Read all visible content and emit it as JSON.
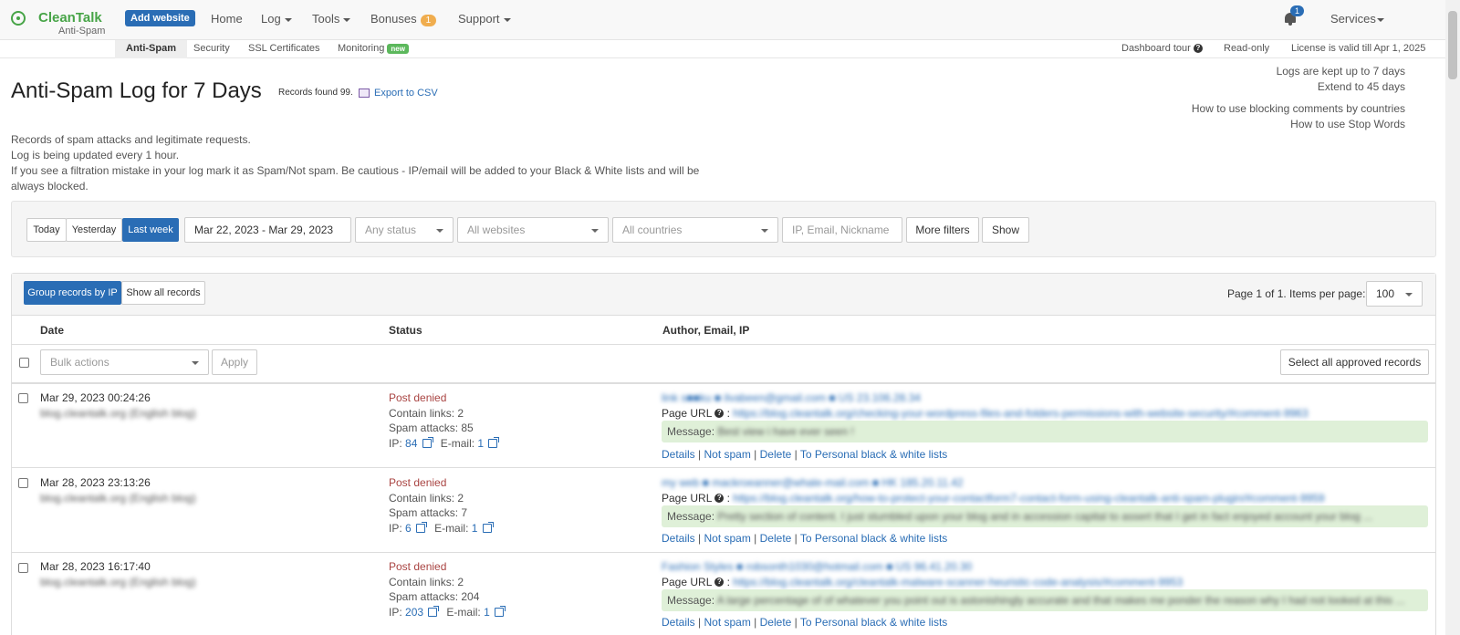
{
  "header": {
    "logo": "CleanTalk",
    "logo_sub": "Anti-Spam",
    "add_website": "Add website",
    "nav": {
      "home": "Home",
      "log": "Log",
      "tools": "Tools",
      "bonuses": "Bonuses",
      "bonuses_count": "1",
      "support": "Support"
    },
    "notifications_count": "1",
    "services": "Services"
  },
  "subnav": {
    "items": [
      "Anti-Spam",
      "Security",
      "SSL Certificates",
      "Monitoring"
    ],
    "monitoring_badge": "new",
    "dashboard_tour": "Dashboard tour",
    "read_only": "Read-only",
    "license": "License is valid till Apr 1, 2025"
  },
  "page": {
    "title": "Anti-Spam Log for 7 Days",
    "records_found": "Records found 99.",
    "export": "Export to CSV",
    "desc_lines": [
      "Records of spam attacks and legitimate requests.",
      "Log is being updated every 1 hour.",
      "If you see a filtration mistake in your log mark it as Spam/Not spam. Be cautious - IP/email will be added to your Black & White lists and will be",
      "always blocked."
    ],
    "right_links": [
      "Logs are kept up to 7 days",
      "Extend to 45 days",
      "How to use blocking comments by countries",
      "How to use Stop Words"
    ]
  },
  "filters": {
    "today": "Today",
    "yesterday": "Yesterday",
    "last_week": "Last week",
    "date_range": "Mar 22, 2023 - Mar 29, 2023",
    "status": "Any status",
    "websites": "All websites",
    "countries": "All countries",
    "search_placeholder": "IP, Email, Nickname",
    "more_filters": "More filters",
    "show": "Show"
  },
  "table": {
    "group_by_ip": "Group records by IP",
    "show_all": "Show all records",
    "pagination": "Page 1 of 1. Items per page:",
    "per_page": "100",
    "columns": [
      "Date",
      "Status",
      "Author, Email, IP"
    ],
    "bulk_actions": "Bulk actions",
    "apply": "Apply",
    "select_all_approved": "Select all approved records",
    "page_url_label": "Page URL",
    "message_label": "Message:",
    "action_labels": [
      "Details",
      "Not spam",
      "Delete",
      "To Personal black & white lists"
    ],
    "contain_links_label": "Contain links:",
    "spam_attacks_label": "Spam attacks:",
    "ip_label": "IP:",
    "email_label": "E-mail:",
    "rows": [
      {
        "date": "Mar 29, 2023 00:24:26",
        "site": "blog.cleantalk.org (English blog)",
        "status": "Post denied",
        "contain_links": "2",
        "spam_attacks": "85",
        "ip_count": "84",
        "email_count": "1",
        "author": "link s■■ku  ■ ilvabeen@gmail.com  ■ US 23.106.28.34",
        "page_url": "https://blog.cleantalk.org/checking-your-wordpress-files-and-folders-permissions-with-website-security/#comment-9963",
        "message": "Best view i have ever seen !"
      },
      {
        "date": "Mar 28, 2023 23:13:26",
        "site": "blog.cleantalk.org (English blog)",
        "status": "Post denied",
        "contain_links": "2",
        "spam_attacks": "7",
        "ip_count": "6",
        "email_count": "1",
        "author": "my web  ■ mackroeanner@whale-mail.com  ■ HK 185.20.11.42",
        "page_url": "https://blog.cleantalk.org/how-to-protect-your-contactform7-contact-form-using-cleantalk-anti-spam-plugin/#comment-9959",
        "message": "Pretty section of content. I just stumbled upon your blog and in accession capital to assert that I get in fact enjoyed account your blog ..."
      },
      {
        "date": "Mar 28, 2023 16:17:40",
        "site": "blog.cleantalk.org (English blog)",
        "status": "Post denied",
        "contain_links": "2",
        "spam_attacks": "204",
        "ip_count": "203",
        "email_count": "1",
        "author": "Fashion Styles  ■ robsonth1030@hotmail.com  ■ US 96.41.20.30",
        "page_url": "https://blog.cleantalk.org/cleantalk-malware-scanner-heuristic-code-analysis/#comment-9953",
        "message": "A large percentage of of whatever you point out is astonishingly accurate and that makes me ponder the reason why I had not looked at this ..."
      }
    ]
  }
}
